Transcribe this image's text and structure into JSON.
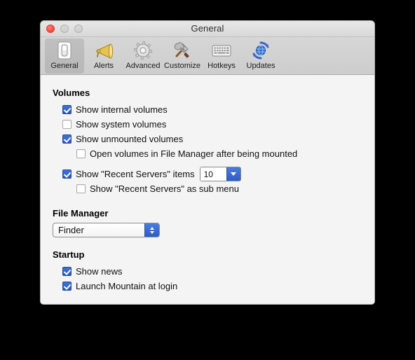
{
  "window": {
    "title": "General",
    "traffic_lights": [
      {
        "name": "close-button",
        "color": "#fb4e42"
      },
      {
        "name": "minimize-button",
        "color": "#d4d4d4"
      },
      {
        "name": "zoom-button",
        "color": "#d4d4d4"
      }
    ]
  },
  "toolbar": {
    "items": [
      {
        "label": "General",
        "icon": "switch-icon",
        "selected": true
      },
      {
        "label": "Alerts",
        "icon": "megaphone-icon",
        "selected": false
      },
      {
        "label": "Advanced",
        "icon": "gear-icon",
        "selected": false
      },
      {
        "label": "Customize",
        "icon": "hammer-wrench-icon",
        "selected": false
      },
      {
        "label": "Hotkeys",
        "icon": "keyboard-icon",
        "selected": false
      },
      {
        "label": "Updates",
        "icon": "update-globe-icon",
        "selected": false
      }
    ]
  },
  "sections": {
    "volumes": {
      "title": "Volumes",
      "items": [
        {
          "label": "Show internal volumes",
          "checked": true
        },
        {
          "label": "Show system volumes",
          "checked": false
        },
        {
          "label": "Show unmounted volumes",
          "checked": true
        },
        {
          "label": "Open volumes in File Manager after being mounted",
          "checked": false
        },
        {
          "label": "Show \"Recent Servers\" items",
          "checked": true
        },
        {
          "label": "Show \"Recent Servers\" as sub menu",
          "checked": false
        }
      ],
      "recent_servers_count": "10"
    },
    "file_manager": {
      "title": "File Manager",
      "selected": "Finder"
    },
    "startup": {
      "title": "Startup",
      "items": [
        {
          "label": "Show news",
          "checked": true
        },
        {
          "label": "Launch Mountain at login",
          "checked": true
        }
      ]
    }
  },
  "colors": {
    "accent_blue": "#2d5cc6",
    "window_bg": "#f4f4f4",
    "toolbar_bg": "#d2d2d2"
  }
}
